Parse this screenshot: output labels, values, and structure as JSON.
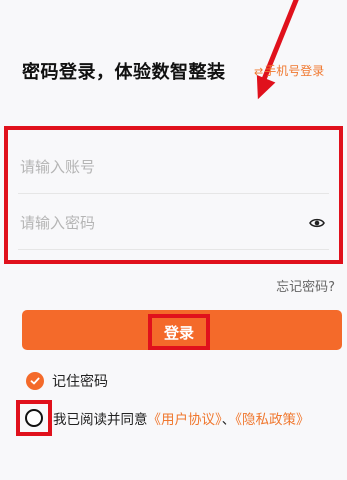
{
  "header": {
    "title": "密码登录，体验数智整装",
    "switch_icon": "swap-arrows-icon",
    "switch_link": "手机号登录"
  },
  "form": {
    "account_placeholder": "请输入账号",
    "account_value": "",
    "password_placeholder": "请输入密码",
    "password_value": "",
    "password_toggle_icon": "eye-icon"
  },
  "forgot_password": "忘记密码?",
  "login_button": "登录",
  "remember": {
    "label": "记住密码",
    "checked": true
  },
  "agreement": {
    "checked": false,
    "prefix": "我已阅读并同意",
    "user_agreement": "《用户协议》",
    "separator": "、",
    "privacy_policy": "《隐私政策》"
  },
  "colors": {
    "accent": "#f46a2a",
    "link": "#f0782f",
    "annotation": "#e0111c"
  }
}
